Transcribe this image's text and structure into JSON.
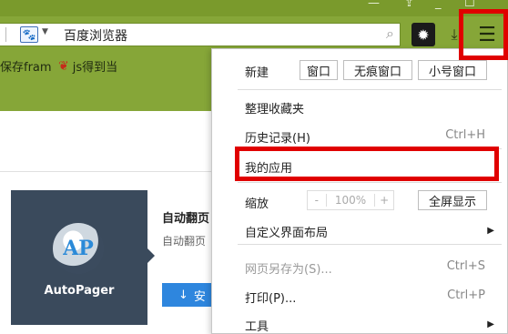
{
  "browser": {
    "address_text": "百度浏览器",
    "window_controls": [
      "minimize-icon",
      "restore-icon"
    ],
    "toolbar_icons": [
      "settings-icon",
      "download-icon",
      "menu-icon"
    ]
  },
  "bookmarks": {
    "items": [
      {
        "label": "保存fram"
      },
      {
        "label": "js得到当"
      }
    ]
  },
  "app": {
    "logo_text": "AP",
    "name": "AutoPager",
    "title": "自动翻页",
    "desc": "自动翻页",
    "install_label": "安"
  },
  "menu": {
    "new_label": "新建",
    "new_window": "窗口",
    "incognito_window": "无痕窗口",
    "small_window": "小号窗口",
    "bookmarks_organize": "整理收藏夹",
    "history": "历史记录(H)",
    "history_shortcut": "Ctrl+H",
    "my_apps": "我的应用",
    "zoom_label": "缩放",
    "zoom_minus": "-",
    "zoom_value": "100%",
    "zoom_plus": "+",
    "fullscreen": "全屏显示",
    "customize_layout": "自定义界面布局",
    "save_as": "网页另存为(S)...",
    "save_as_shortcut": "Ctrl+S",
    "print": "打印(P)...",
    "print_shortcut": "Ctrl+P",
    "tools": "工具"
  },
  "colors": {
    "theme_green": "#86a638",
    "highlight_red": "#e00000",
    "tile_bg": "#3a4a5c",
    "install_blue": "#2e86de"
  }
}
